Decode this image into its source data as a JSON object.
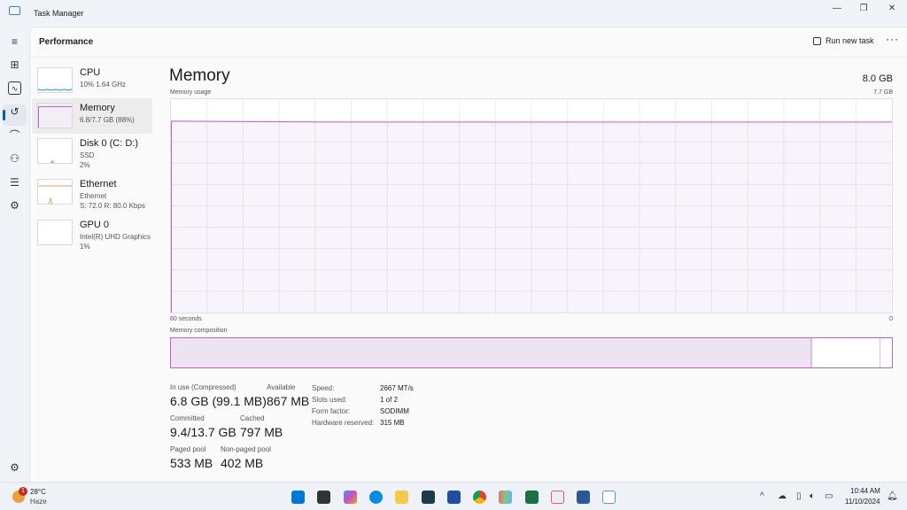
{
  "window": {
    "title": "Task Manager",
    "minimize": "—",
    "restore": "❐",
    "close": "✕"
  },
  "rail": [
    "menu-icon",
    "processes-icon",
    "performance-icon",
    "app-history-icon",
    "startup-icon",
    "users-icon",
    "details-icon",
    "services-icon",
    "settings-icon"
  ],
  "header": {
    "title": "Performance",
    "run_new_task": "Run new task",
    "more": "···"
  },
  "sidebar": [
    {
      "name": "CPU",
      "sub1": "10%  1.64 GHz",
      "sub2": "",
      "color": "#1f8fd6"
    },
    {
      "name": "Memory",
      "sub1": "6.8/7.7 GB (88%)",
      "sub2": "",
      "color": "#b567c8"
    },
    {
      "name": "Disk 0 (C: D:)",
      "sub1": "SSD",
      "sub2": "2%",
      "color": "#4caf50"
    },
    {
      "name": "Ethernet",
      "sub1": "Ethernet",
      "sub2": "S: 72.0  R: 80.0 Kbps",
      "color": "#e59a6b"
    },
    {
      "name": "GPU 0",
      "sub1": "Intel(R) UHD Graphics",
      "sub2": "1%",
      "color": "#1f8fd6"
    }
  ],
  "memory": {
    "title": "Memory",
    "total": "8.0 GB",
    "usage_label": "Memory usage",
    "usage_max": "7.7 GB",
    "time_left": "60 seconds",
    "time_right": "0",
    "composition_label": "Memory composition",
    "usage_percent": 88,
    "composition": {
      "in_use_fraction": 0.89,
      "modified_fraction": 0.01
    },
    "stats": [
      {
        "label": "In use (Compressed)",
        "value": "6.8 GB (99.1 MB)"
      },
      {
        "label": "Available",
        "value": "867 MB"
      },
      {
        "label": "Committed",
        "value": "9.4/13.7 GB"
      },
      {
        "label": "Cached",
        "value": "797 MB"
      },
      {
        "label": "Paged pool",
        "value": "533 MB"
      },
      {
        "label": "Non-paged pool",
        "value": "402 MB"
      }
    ],
    "details": [
      {
        "k": "Speed:",
        "v": "2667 MT/s"
      },
      {
        "k": "Slots used:",
        "v": "1 of 2"
      },
      {
        "k": "Form factor:",
        "v": "SODIMM"
      },
      {
        "k": "Hardware reserved:",
        "v": "315 MB"
      }
    ],
    "accent": "#b567c8"
  },
  "taskbar": {
    "temp": "28°C",
    "weather": "Haze",
    "badge": "1",
    "time": "10:44 AM",
    "date": "11/10/2024"
  }
}
